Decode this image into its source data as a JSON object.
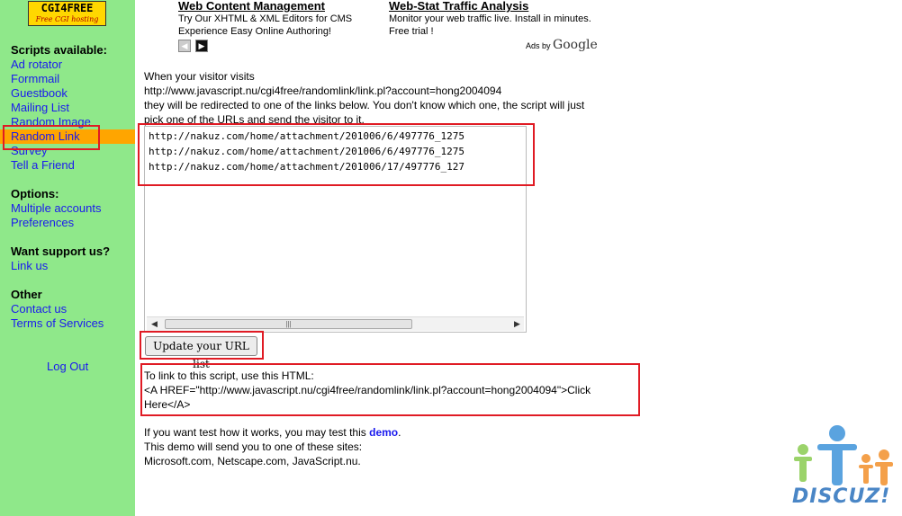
{
  "logo": {
    "main": "CGI4FREE",
    "sub": "Free CGI hosting"
  },
  "sidebar": {
    "scripts": {
      "heading": "Scripts available:",
      "items": [
        "Ad rotator",
        "Formmail",
        "Guestbook",
        "Mailing List",
        "Random Image",
        "Random Link",
        "Survey",
        "Tell a Friend"
      ],
      "active_index": 5
    },
    "options": {
      "heading": "Options:",
      "items": [
        "Multiple accounts",
        "Preferences"
      ]
    },
    "support": {
      "heading": "Want support us?",
      "items": [
        "Link us"
      ]
    },
    "other": {
      "heading": "Other",
      "items": [
        "Contact us",
        "Terms of Services"
      ]
    },
    "logout": "Log Out"
  },
  "ads": {
    "items": [
      {
        "title": "Web Content Management",
        "text": "Try Our XHTML & XML Editors for CMS Experience Easy Online Authoring!"
      },
      {
        "title": "Web-Stat Traffic Analysis",
        "text": "Monitor your web traffic live. Install in minutes. Free trial !"
      }
    ],
    "prev_icon": "chevron-left-icon",
    "next_icon": "chevron-right-icon",
    "ads_by": "Ads by",
    "google": "Google"
  },
  "main": {
    "intro_line1": "When your visitor visits",
    "intro_url": "http://www.javascript.nu/cgi4free/randomlink/link.pl?account=hong2004094",
    "intro_line2": "they will be redirected to one of the links below. You don't know which one, the script will just",
    "intro_line3": "pick one of the URLs and send the visitor to it.",
    "url_list": [
      "http://nakuz.com/home/attachment/201006/6/497776_1275",
      "http://nakuz.com/home/attachment/201006/6/497776_1275",
      "http://nakuz.com/home/attachment/201006/17/497776_127"
    ],
    "update_button": "Update your URL list",
    "link_heading": "To link to this script, use this HTML:",
    "link_html_line1": "<A HREF=\"http://www.javascript.nu/cgi4free/randomlink/link.pl?account=hong2004094\">Click",
    "link_html_line2": "Here</A>",
    "test_prefix": "If you want test how it works, you may test this",
    "test_link": "demo",
    "test_suffix": ".",
    "demo_line": "This demo will send you to one of these sites:",
    "demo_sites": "Microsoft.com, Netscape.com, JavaScript.nu."
  },
  "watermark": {
    "text": "DISCUZ!"
  },
  "colors": {
    "sidebar_bg": "#8fe88a",
    "active_bg": "#ffa500",
    "link": "#1a1aee",
    "highlight": "#e01b24",
    "logo_bg": "#ffd700"
  }
}
